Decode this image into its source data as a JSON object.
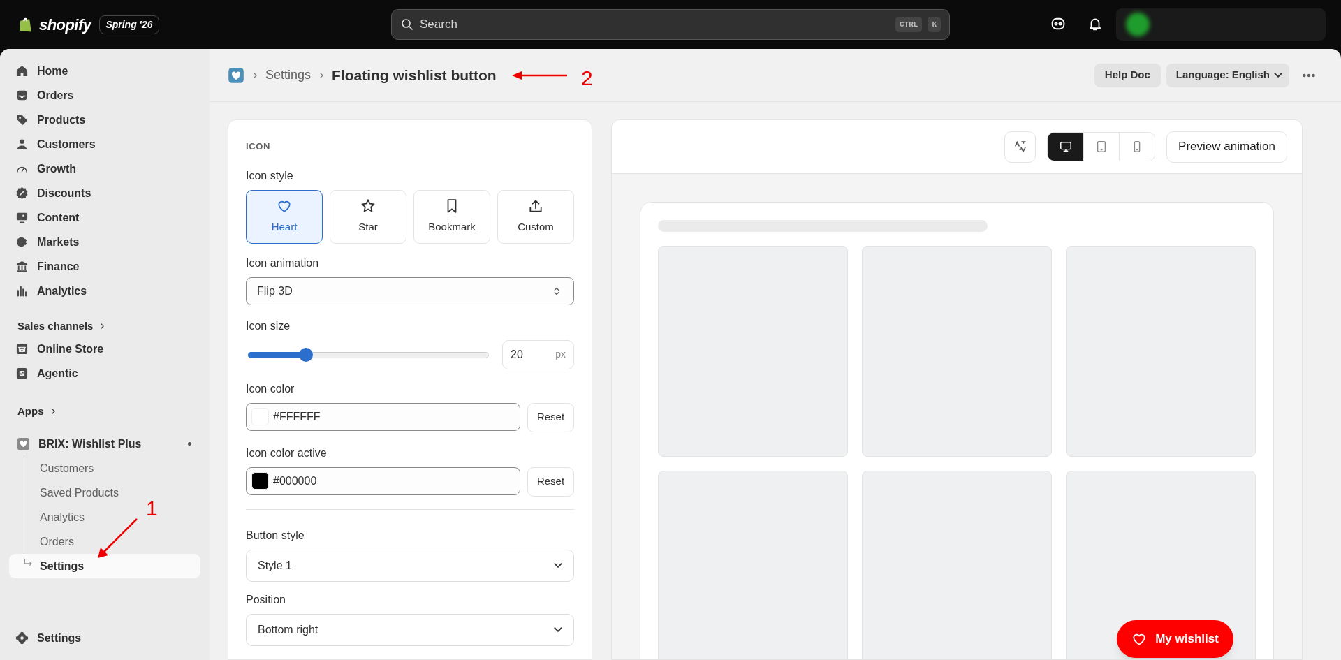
{
  "top_bar": {
    "logo_text": "shopify",
    "edition": "Spring '26",
    "search": {
      "placeholder": "Search",
      "shortcut": [
        "CTRL",
        "K"
      ]
    }
  },
  "sidebar": {
    "items": [
      {
        "label": "Home"
      },
      {
        "label": "Orders"
      },
      {
        "label": "Products"
      },
      {
        "label": "Customers"
      },
      {
        "label": "Growth"
      },
      {
        "label": "Discounts"
      },
      {
        "label": "Content"
      },
      {
        "label": "Markets"
      },
      {
        "label": "Finance"
      },
      {
        "label": "Analytics"
      }
    ],
    "sales_channels": {
      "heading": "Sales channels",
      "items": [
        {
          "label": "Online Store"
        },
        {
          "label": "Agentic"
        }
      ]
    },
    "apps": {
      "heading": "Apps",
      "app": {
        "name": "BRIX: Wishlist Plus",
        "children": [
          {
            "label": "Customers",
            "selected": false
          },
          {
            "label": "Saved Products",
            "selected": false
          },
          {
            "label": "Analytics",
            "selected": false
          },
          {
            "label": "Orders",
            "selected": false
          },
          {
            "label": "Settings",
            "selected": true
          }
        ]
      }
    },
    "footer_item": {
      "label": "Settings"
    }
  },
  "header": {
    "breadcrumb": [
      "Settings",
      "Floating wishlist button"
    ],
    "help_button": "Help Doc",
    "language_button": "Language: English"
  },
  "settings_panel": {
    "section_title": "ICON",
    "icon_style": {
      "label": "Icon style",
      "options": [
        {
          "label": "Heart",
          "selected": true
        },
        {
          "label": "Star",
          "selected": false
        },
        {
          "label": "Bookmark",
          "selected": false
        },
        {
          "label": "Custom",
          "selected": false
        }
      ]
    },
    "icon_animation": {
      "label": "Icon animation",
      "value": "Flip 3D"
    },
    "icon_size": {
      "label": "Icon size",
      "level": 0.24,
      "value": "20",
      "unit": "px"
    },
    "colors": [
      {
        "label": "Icon color",
        "value": "#FFFFFF",
        "color": "#ffffff",
        "reset": "Reset"
      },
      {
        "label": "Icon color active",
        "value": "#000000",
        "color": "#000000",
        "reset": "Reset"
      }
    ],
    "button_style": {
      "label": "Button style",
      "value": "Style 1"
    },
    "position": {
      "label": "Position",
      "value": "Bottom right"
    }
  },
  "preview": {
    "devices": [
      {
        "selected": true
      },
      {
        "selected": false
      },
      {
        "selected": false
      }
    ],
    "preview_button": "Preview animation",
    "wishlist_button": "My wishlist"
  },
  "annotations": [
    {
      "label": "1"
    },
    {
      "label": "2"
    }
  ]
}
